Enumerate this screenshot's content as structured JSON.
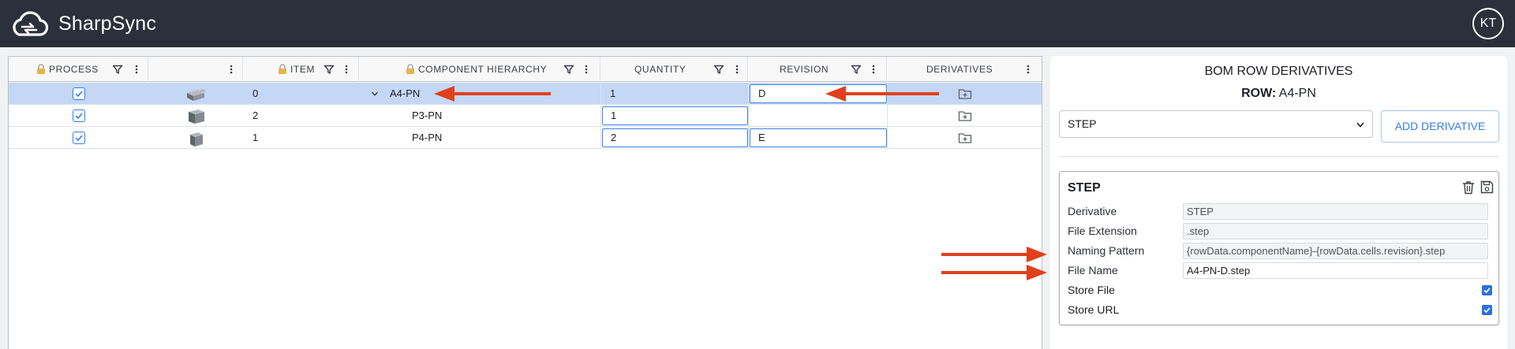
{
  "app": {
    "title": "SharpSync",
    "user_initials": "KT"
  },
  "grid": {
    "columns": [
      {
        "label": "PROCESS"
      },
      {
        "label": ""
      },
      {
        "label": "ITEM"
      },
      {
        "label": "COMPONENT HIERARCHY"
      },
      {
        "label": "QUANTITY"
      },
      {
        "label": "REVISION"
      },
      {
        "label": "DERIVATIVES"
      }
    ],
    "rows": [
      {
        "process": true,
        "item": "0",
        "component": "A4-PN",
        "quantity": "1",
        "revision": "D"
      },
      {
        "process": true,
        "item": "2",
        "component": "P3-PN",
        "quantity": "1",
        "revision": ""
      },
      {
        "process": true,
        "item": "1",
        "component": "P4-PN",
        "quantity": "2",
        "revision": "E"
      }
    ]
  },
  "panel": {
    "title": "BOM ROW DERIVATIVES",
    "row_label": "ROW:",
    "row_value": "A4-PN",
    "select_value": "STEP",
    "add_button": "ADD DERIVATIVE",
    "card": {
      "title": "STEP",
      "fields": [
        {
          "label": "Derivative",
          "value": "STEP"
        },
        {
          "label": "File Extension",
          "value": ".step"
        },
        {
          "label": "Naming Pattern",
          "value": "{rowData.componentName}-{rowData.cells.revision}.step"
        },
        {
          "label": "File Name",
          "value": "A4-PN-D.step"
        }
      ],
      "toggles": [
        {
          "label": "Store File",
          "checked": true
        },
        {
          "label": "Store URL",
          "checked": true
        }
      ]
    }
  },
  "colors": {
    "topbar": "#2b303b",
    "selected_row": "#c4d7f5",
    "accent_blue": "#2e7cf6",
    "annotation_arrow": "#e0401c"
  },
  "icons": [
    "cloud-sync-logo-icon",
    "lock-icon",
    "filter-icon",
    "column-menu-icon",
    "chevron-down-icon",
    "part-thumbnail-icon",
    "folder-plus-icon",
    "trash-icon",
    "save-icon",
    "checkmark-icon"
  ]
}
